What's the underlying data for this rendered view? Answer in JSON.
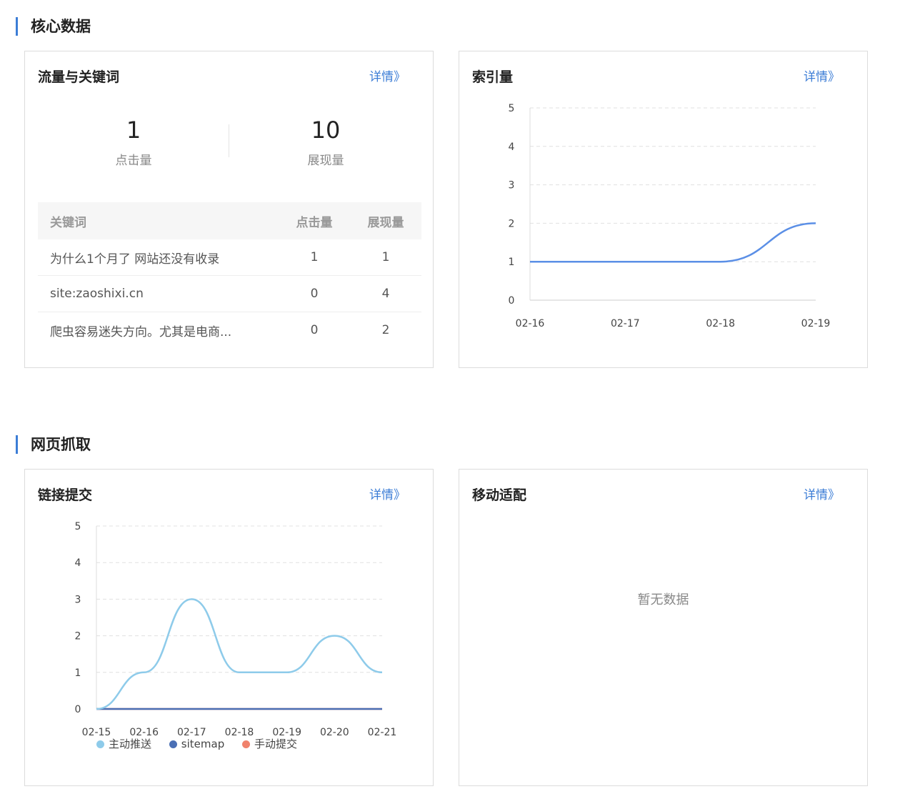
{
  "sections": {
    "core": "核心数据",
    "crawl": "网页抓取"
  },
  "traffic": {
    "title": "流量与关键词",
    "detail": "详情》",
    "clicks_value": "1",
    "clicks_label": "点击量",
    "impressions_value": "10",
    "impressions_label": "展现量",
    "table": {
      "headers": [
        "关键词",
        "点击量",
        "展现量"
      ],
      "rows": [
        [
          "为什么1个月了 网站还没有收录",
          "1",
          "1"
        ],
        [
          "site:zaoshixi.cn",
          "0",
          "4"
        ],
        [
          "爬虫容易迷失方向。尤其是电商...",
          "0",
          "2"
        ]
      ]
    }
  },
  "index": {
    "title": "索引量",
    "detail": "详情》"
  },
  "links": {
    "title": "链接提交",
    "detail": "详情》"
  },
  "mobile": {
    "title": "移动适配",
    "detail": "详情》",
    "empty": "暂无数据"
  },
  "chart_data": [
    {
      "type": "line",
      "title": "索引量",
      "categories": [
        "02-16",
        "02-17",
        "02-18",
        "02-19"
      ],
      "series": [
        {
          "values": [
            1,
            1,
            1,
            2
          ],
          "color": "#5b8fe6"
        }
      ],
      "ylim": [
        0,
        5
      ],
      "yticks": [
        0,
        1,
        2,
        3,
        4,
        5
      ],
      "grid": true,
      "legend": "none"
    },
    {
      "type": "line",
      "title": "链接提交",
      "categories": [
        "02-15",
        "02-16",
        "02-17",
        "02-18",
        "02-19",
        "02-20",
        "02-21"
      ],
      "series": [
        {
          "name": "主动推送",
          "values": [
            0,
            1,
            3,
            1,
            1,
            2,
            1
          ],
          "color": "#8ecbea"
        },
        {
          "name": "sitemap",
          "values": [
            0,
            0,
            0,
            0,
            0,
            0,
            0
          ],
          "color": "#4a6fb5"
        },
        {
          "name": "手动提交",
          "values": [
            0,
            0,
            0,
            0,
            0,
            0,
            0
          ],
          "color": "#f0826c"
        }
      ],
      "ylim": [
        0,
        5
      ],
      "yticks": [
        0,
        1,
        2,
        3,
        4,
        5
      ],
      "grid": true,
      "legend": "bottom-left"
    }
  ]
}
